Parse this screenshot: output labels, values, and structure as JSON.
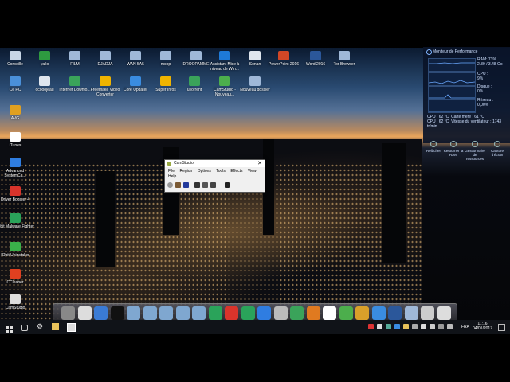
{
  "desktop": {
    "row1": [
      {
        "label": "Corbeille",
        "icon": "recycle-bin-icon",
        "color": "#c8d6e6"
      },
      {
        "label": "yallo",
        "icon": "tree-icon",
        "color": "#2e9a40"
      },
      {
        "label": "FILM",
        "icon": "folder-icon",
        "color": "#9fb8d8"
      },
      {
        "label": "DJADJA",
        "icon": "folder-icon",
        "color": "#9fb8d8"
      },
      {
        "label": "WAN 5A5",
        "icon": "folder-icon",
        "color": "#9fb8d8"
      },
      {
        "label": "mcop",
        "icon": "folder-icon",
        "color": "#9fb8d8"
      },
      {
        "label": "DROOPAMME",
        "icon": "folder-icon",
        "color": "#9fb8d8"
      },
      {
        "label": "Assistant Mise à niveau de Win...",
        "icon": "windows-icon",
        "color": "#1e7ad8"
      },
      {
        "label": "Sonan",
        "icon": "document-icon",
        "color": "#dfe6ee"
      },
      {
        "label": "PowerPoint 2016",
        "icon": "powerpoint-icon",
        "color": "#d24726"
      },
      {
        "label": "Word 2016",
        "icon": "word-icon",
        "color": "#2b579a"
      },
      {
        "label": "Tor Browser",
        "icon": "folder-icon",
        "color": "#9fb8d8"
      }
    ],
    "row2": [
      {
        "label": "Ce PC",
        "icon": "computer-icon",
        "color": "#4a90d9"
      },
      {
        "label": "ocooojeau",
        "icon": "keyboard-icon",
        "color": "#dfe6ee"
      },
      {
        "label": "Internet Downlo...",
        "icon": "globe-icon",
        "color": "#3aa35a"
      },
      {
        "label": "Freemake Video Converter",
        "icon": "converter-icon",
        "color": "#f0b400"
      },
      {
        "label": "Core Updater",
        "icon": "updater-icon",
        "color": "#3a8ce0"
      },
      {
        "label": "Super Infos",
        "icon": "barcode-icon",
        "color": "#f0b400"
      },
      {
        "label": "uTorrent",
        "icon": "utorrent-icon",
        "color": "#3aa35a"
      },
      {
        "label": "CamStudio - Nouveau...",
        "icon": "globe-icon",
        "color": "#4cae4c"
      },
      {
        "label": "Nouveau dossier",
        "icon": "folder-icon",
        "color": "#9fb8d8"
      }
    ],
    "column": [
      {
        "label": "AVG",
        "icon": "avg-icon",
        "color": "#e0a020"
      },
      {
        "label": "iTunes",
        "icon": "music-icon",
        "color": "#ffffff"
      },
      {
        "label": "Advanced SystemCa...",
        "icon": "gear-icon",
        "color": "#2f7de1"
      },
      {
        "label": "Driver Booster 4",
        "icon": "driver-booster-icon",
        "color": "#d9342b"
      },
      {
        "label": "IObit Malware Fighter",
        "icon": "shield-icon",
        "color": "#2aa35a"
      },
      {
        "label": "IObit Uninstaller",
        "icon": "uninstaller-icon",
        "color": "#3ab04a"
      },
      {
        "label": "CCleaner",
        "icon": "ccleaner-icon",
        "color": "#e04020"
      },
      {
        "label": "CamStudio",
        "icon": "camstudio-icon",
        "color": "#dddddd"
      }
    ]
  },
  "perf_monitor": {
    "title": "Moniteur de Performance",
    "ram_label": "RAM: 73%",
    "ram_value": "2.89 / 3.48 Go",
    "cpu_label": "CPU :",
    "cpu_value": "9%",
    "disk_label": "Disque :",
    "disk_value": "0%",
    "net_label": "Réseau :",
    "net_value": "0,00%",
    "cpu_temp": "CPU : 62 °C",
    "card_temp": "Carte mère : 61 °C",
    "cpu_fan": "CPU : 62 °C",
    "fan_speed": "Vitesse du ventilateur : 1743 tr/min",
    "buttons": [
      "Relâcher",
      "Retourner la RAM",
      "Gestionnaire de ressources",
      "Capture d'écran"
    ]
  },
  "camstudio": {
    "title": "CamStudio",
    "menu": [
      "File",
      "Region",
      "Options",
      "Tools",
      "Effects",
      "View"
    ],
    "menu2": "Help"
  },
  "dock": {
    "items": [
      "finder-icon",
      "monitor-icon",
      "finder-face-icon",
      "terminal-icon",
      "folder-icon",
      "folder-icon",
      "folder-icon",
      "folder-icon",
      "folder-icon",
      "uninstaller-icon",
      "driver-booster-icon",
      "shield-icon",
      "updater-icon",
      "screen-icon",
      "cloud-icon",
      "vlc-icon",
      "itunes-icon",
      "globe-icon",
      "apps-icon",
      "media-icon",
      "word-icon",
      "files-icon",
      "settings-icon",
      "screen-icon"
    ]
  },
  "taskbar": {
    "time": "11:16",
    "date": "04/01/2017",
    "lang": "FRA"
  },
  "colors": {
    "accent": "#1e7ad8",
    "perf_bg": "#0a1428"
  }
}
